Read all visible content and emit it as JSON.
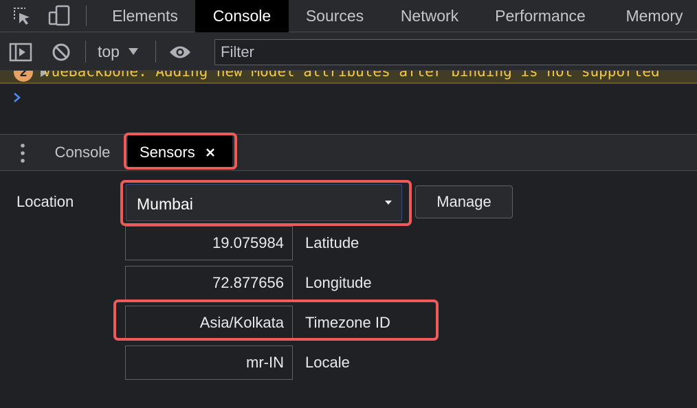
{
  "top_tabs": [
    "Elements",
    "Console",
    "Sources",
    "Network",
    "Performance",
    "Memory"
  ],
  "toolbar": {
    "context": "top",
    "filter_placeholder": "Filter"
  },
  "console": {
    "warning_count": "2",
    "warning_text": "VueBackbone: Adding new Model attributes after binding is not supported"
  },
  "drawer": {
    "tabs": [
      "Console",
      "Sensors"
    ],
    "active_tab": "Sensors"
  },
  "sensors": {
    "location_label": "Location",
    "location_value": "Mumbai",
    "manage_label": "Manage",
    "fields": [
      {
        "value": "19.075984",
        "label": "Latitude"
      },
      {
        "value": "72.877656",
        "label": "Longitude"
      },
      {
        "value": "Asia/Kolkata",
        "label": "Timezone ID"
      },
      {
        "value": "mr-IN",
        "label": "Locale"
      }
    ]
  },
  "colors": {
    "highlight": "#ec5b59",
    "warning": "#f2c94c",
    "prompt": "#4e8cf5"
  }
}
